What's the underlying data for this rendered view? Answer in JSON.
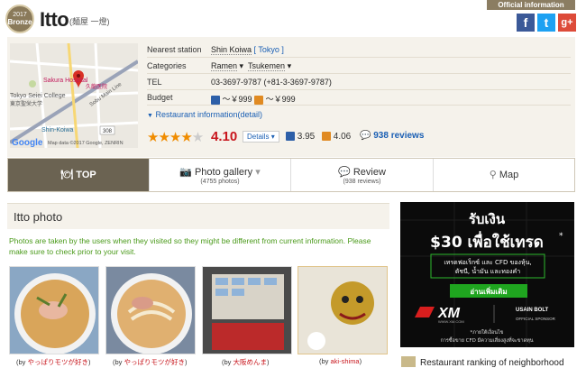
{
  "badge": {
    "year": "2017",
    "label": "Bronze"
  },
  "restaurant": {
    "name": "Itto",
    "subtitle": "(麺屋 一燈)"
  },
  "official": "Official information",
  "social": {
    "fb": "f",
    "tw": "t",
    "gp": "g+"
  },
  "map": {
    "poi1": "Sakura Hospital",
    "poi1jp": "久龍医院",
    "poi2": "Tokyo Seiei College",
    "poi2jp": "東京聖栄大学",
    "line": "Sobu Main Line",
    "station": "Shin-Koiwa",
    "route": "308",
    "credit": "Map data ©2017 Google, ZENRIN",
    "google": "Google"
  },
  "info": {
    "station_label": "Nearest station",
    "station": "Shin Koiwa",
    "station_city": "[ Tokyo ]",
    "categories_label": "Categories",
    "cat1": "Ramen",
    "cat2": "Tsukemen",
    "tel_label": "TEL",
    "tel": "03-3697-9787 (+81-3-3697-9787)",
    "budget_label": "Budget",
    "budget_night": "～￥999",
    "budget_lunch": "～￥999",
    "detail_link": "Restaurant information(detail)"
  },
  "rating": {
    "stars": "★★★★",
    "star_half": "★",
    "score": "4.10",
    "details": "Details",
    "night": "3.95",
    "lunch": "4.06",
    "reviews": "938 reviews"
  },
  "nav": {
    "top": "TOP",
    "gallery": "Photo gallery",
    "gallery_sub": "(4755 photos)",
    "review": "Review",
    "review_sub": "(938 reviews)",
    "map": "Map"
  },
  "photos": {
    "title": "Itto photo",
    "note": "Photos are taken by the users when they visited so they might be different from current information. Please make sure to check prior to your visit.",
    "captions": [
      {
        "by": "(by ",
        "name": "やっぱりモツが好き",
        "end": ")"
      },
      {
        "by": "(by ",
        "name": "やっぱりモツが好き",
        "end": ")"
      },
      {
        "by": "(by ",
        "name": "大阪めんま",
        "end": ")"
      },
      {
        "by": "(by ",
        "name": "aki-shima",
        "end": ")"
      }
    ]
  },
  "ad": {
    "title": "รับเงิน",
    "amount": "$30 เพื่อใช้เทรด",
    "star": "*",
    "line1": "เทรดฟอเร็กซ์ และ CFD ของหุ้น,",
    "line2": "ดัชนี, น้ำมัน และทองคำ",
    "cta": "อ่านเพิ่มเติม",
    "brand": "XM",
    "brand_url": "WWW.XM.COM",
    "sponsor": "USAIN BOLT",
    "sponsor_sub": "OFFICIAL SPONSOR",
    "foot1": "*ภายใต้เงื่อนไข",
    "foot2": "การซื้อขาย CFD มีความเสี่ยงสูงที่จะขาดทุน"
  },
  "ranking": "Restaurant ranking of neighborhood",
  "colors": {
    "accent": "#c8161d",
    "nav_active": "#6b6352",
    "green_note": "#4a9a1a"
  }
}
